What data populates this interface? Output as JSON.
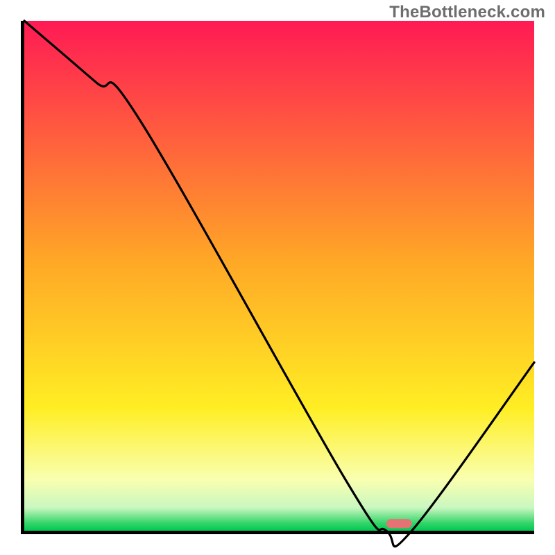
{
  "watermark": "TheBottleneck.com",
  "chart_data": {
    "type": "line",
    "title": "",
    "xlabel": "",
    "ylabel": "",
    "xlim": [
      0,
      100
    ],
    "ylim": [
      0,
      100
    ],
    "x": [
      0,
      14,
      23,
      63,
      71,
      76,
      100
    ],
    "values": [
      100,
      88,
      80,
      10,
      0,
      0,
      33
    ],
    "gradient_stops": [
      {
        "offset": 0.0,
        "color": "#ff1a54"
      },
      {
        "offset": 0.47,
        "color": "#ffa726"
      },
      {
        "offset": 0.76,
        "color": "#ffee24"
      },
      {
        "offset": 0.9,
        "color": "#f9ffb0"
      },
      {
        "offset": 0.955,
        "color": "#c9f7c0"
      },
      {
        "offset": 0.985,
        "color": "#35d56a"
      },
      {
        "offset": 1.0,
        "color": "#00c853"
      }
    ],
    "marker": {
      "x_start": 71,
      "x_end": 76,
      "y": 0.5,
      "color": "#e57373",
      "height_pct": 1.8
    }
  }
}
